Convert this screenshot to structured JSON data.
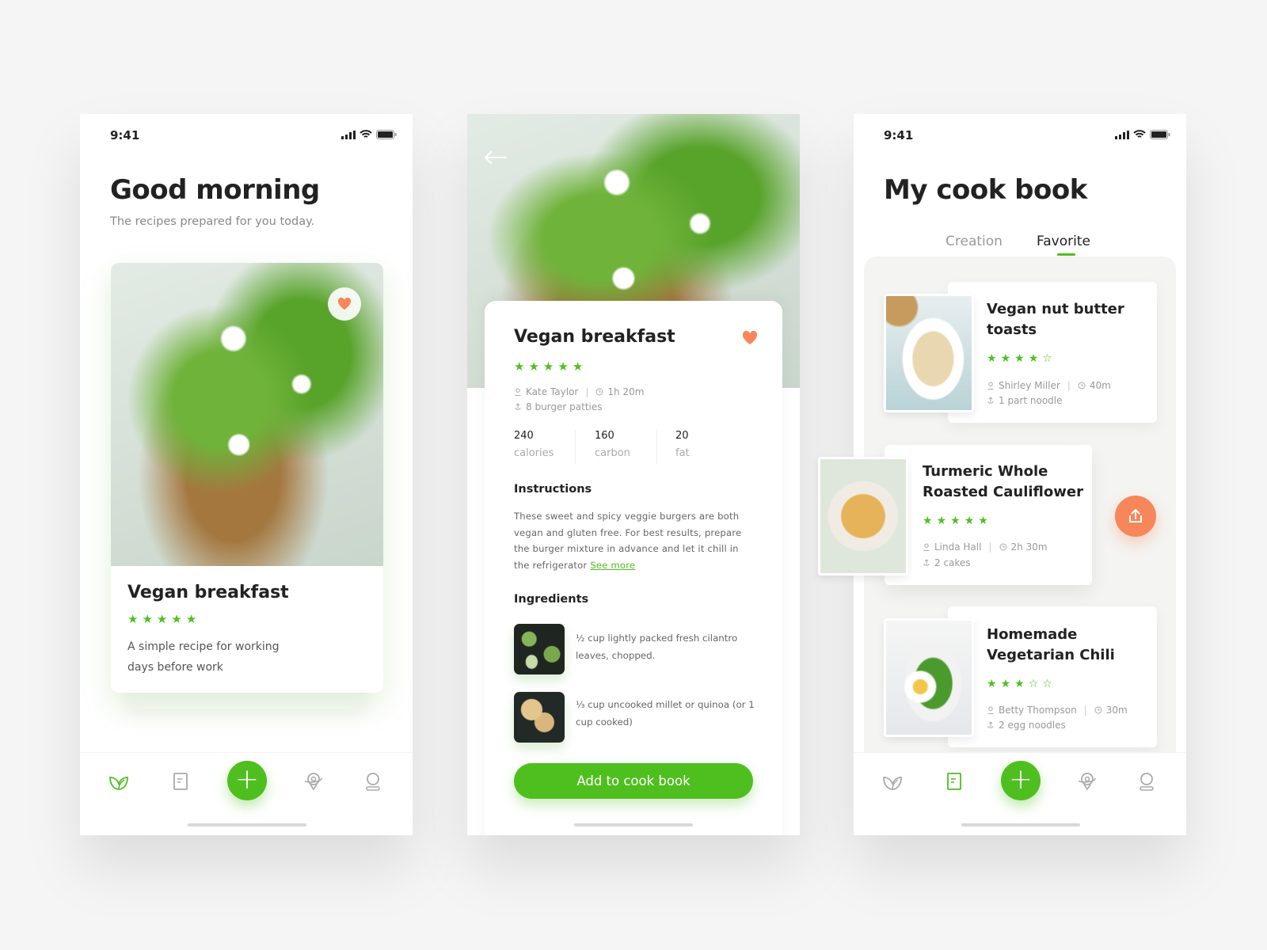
{
  "colors": {
    "accent": "#4fbf1f",
    "heart": "#f7875a",
    "share": "#f7875a"
  },
  "status_bar": {
    "time": "9:41",
    "icons": [
      "signal-icon",
      "wifi-icon",
      "battery-icon"
    ]
  },
  "home": {
    "title": "Good morning",
    "subtitle": "The recipes prepared for you today.",
    "card": {
      "title": "Vegan breakfast",
      "rating": 5,
      "description_line1": "A simple recipe for working",
      "description_line2": "days before work",
      "favorite": true
    }
  },
  "detail": {
    "title": "Vegan breakfast",
    "rating": 5,
    "author": "Kate Taylor",
    "duration": "1h 20m",
    "servings": "8 burger patties",
    "stats": [
      {
        "value": "240",
        "label": "calories"
      },
      {
        "value": "160",
        "label": "carbon"
      },
      {
        "value": "20",
        "label": "fat"
      }
    ],
    "instructions_heading": "Instructions",
    "instructions": "These sweet and spicy veggie burgers are both vegan and gluten free. For best results, prepare the burger mixture in advance and let it chill in the refrigerator",
    "see_more": "See more",
    "ingredients_heading": "Ingredients",
    "ingredients": [
      {
        "text": "½ cup lightly packed fresh cilantro leaves, chopped."
      },
      {
        "text": "⅓ cup uncooked millet or quinoa (or 1 cup cooked)"
      }
    ],
    "add_button": "Add to cook book"
  },
  "cookbook": {
    "title": "My cook book",
    "tabs": [
      {
        "label": "Creation",
        "active": false
      },
      {
        "label": "Favorite",
        "active": true
      }
    ],
    "recipes": [
      {
        "title_line1": "Vegan nut butter",
        "title_line2": "toasts",
        "rating": 4,
        "author": "Shirley Miller",
        "duration": "40m",
        "servings": "1 part noodle"
      },
      {
        "title_line1": "Turmeric Whole",
        "title_line2": "Roasted Cauliflower",
        "rating": 5,
        "author": "Linda Hall",
        "duration": "2h 30m",
        "servings": "2 cakes"
      },
      {
        "title_line1": "Homemade",
        "title_line2": "Vegetarian Chili",
        "rating": 3,
        "author": "Betty Thompson",
        "duration": "30m",
        "servings": "2 egg noodles"
      }
    ]
  },
  "bottom_nav": {
    "items": [
      "leaf-icon",
      "book-icon",
      "plus-icon",
      "location-icon",
      "profile-icon"
    ],
    "active_home": "leaf-icon",
    "active_cookbook": "book-icon"
  }
}
